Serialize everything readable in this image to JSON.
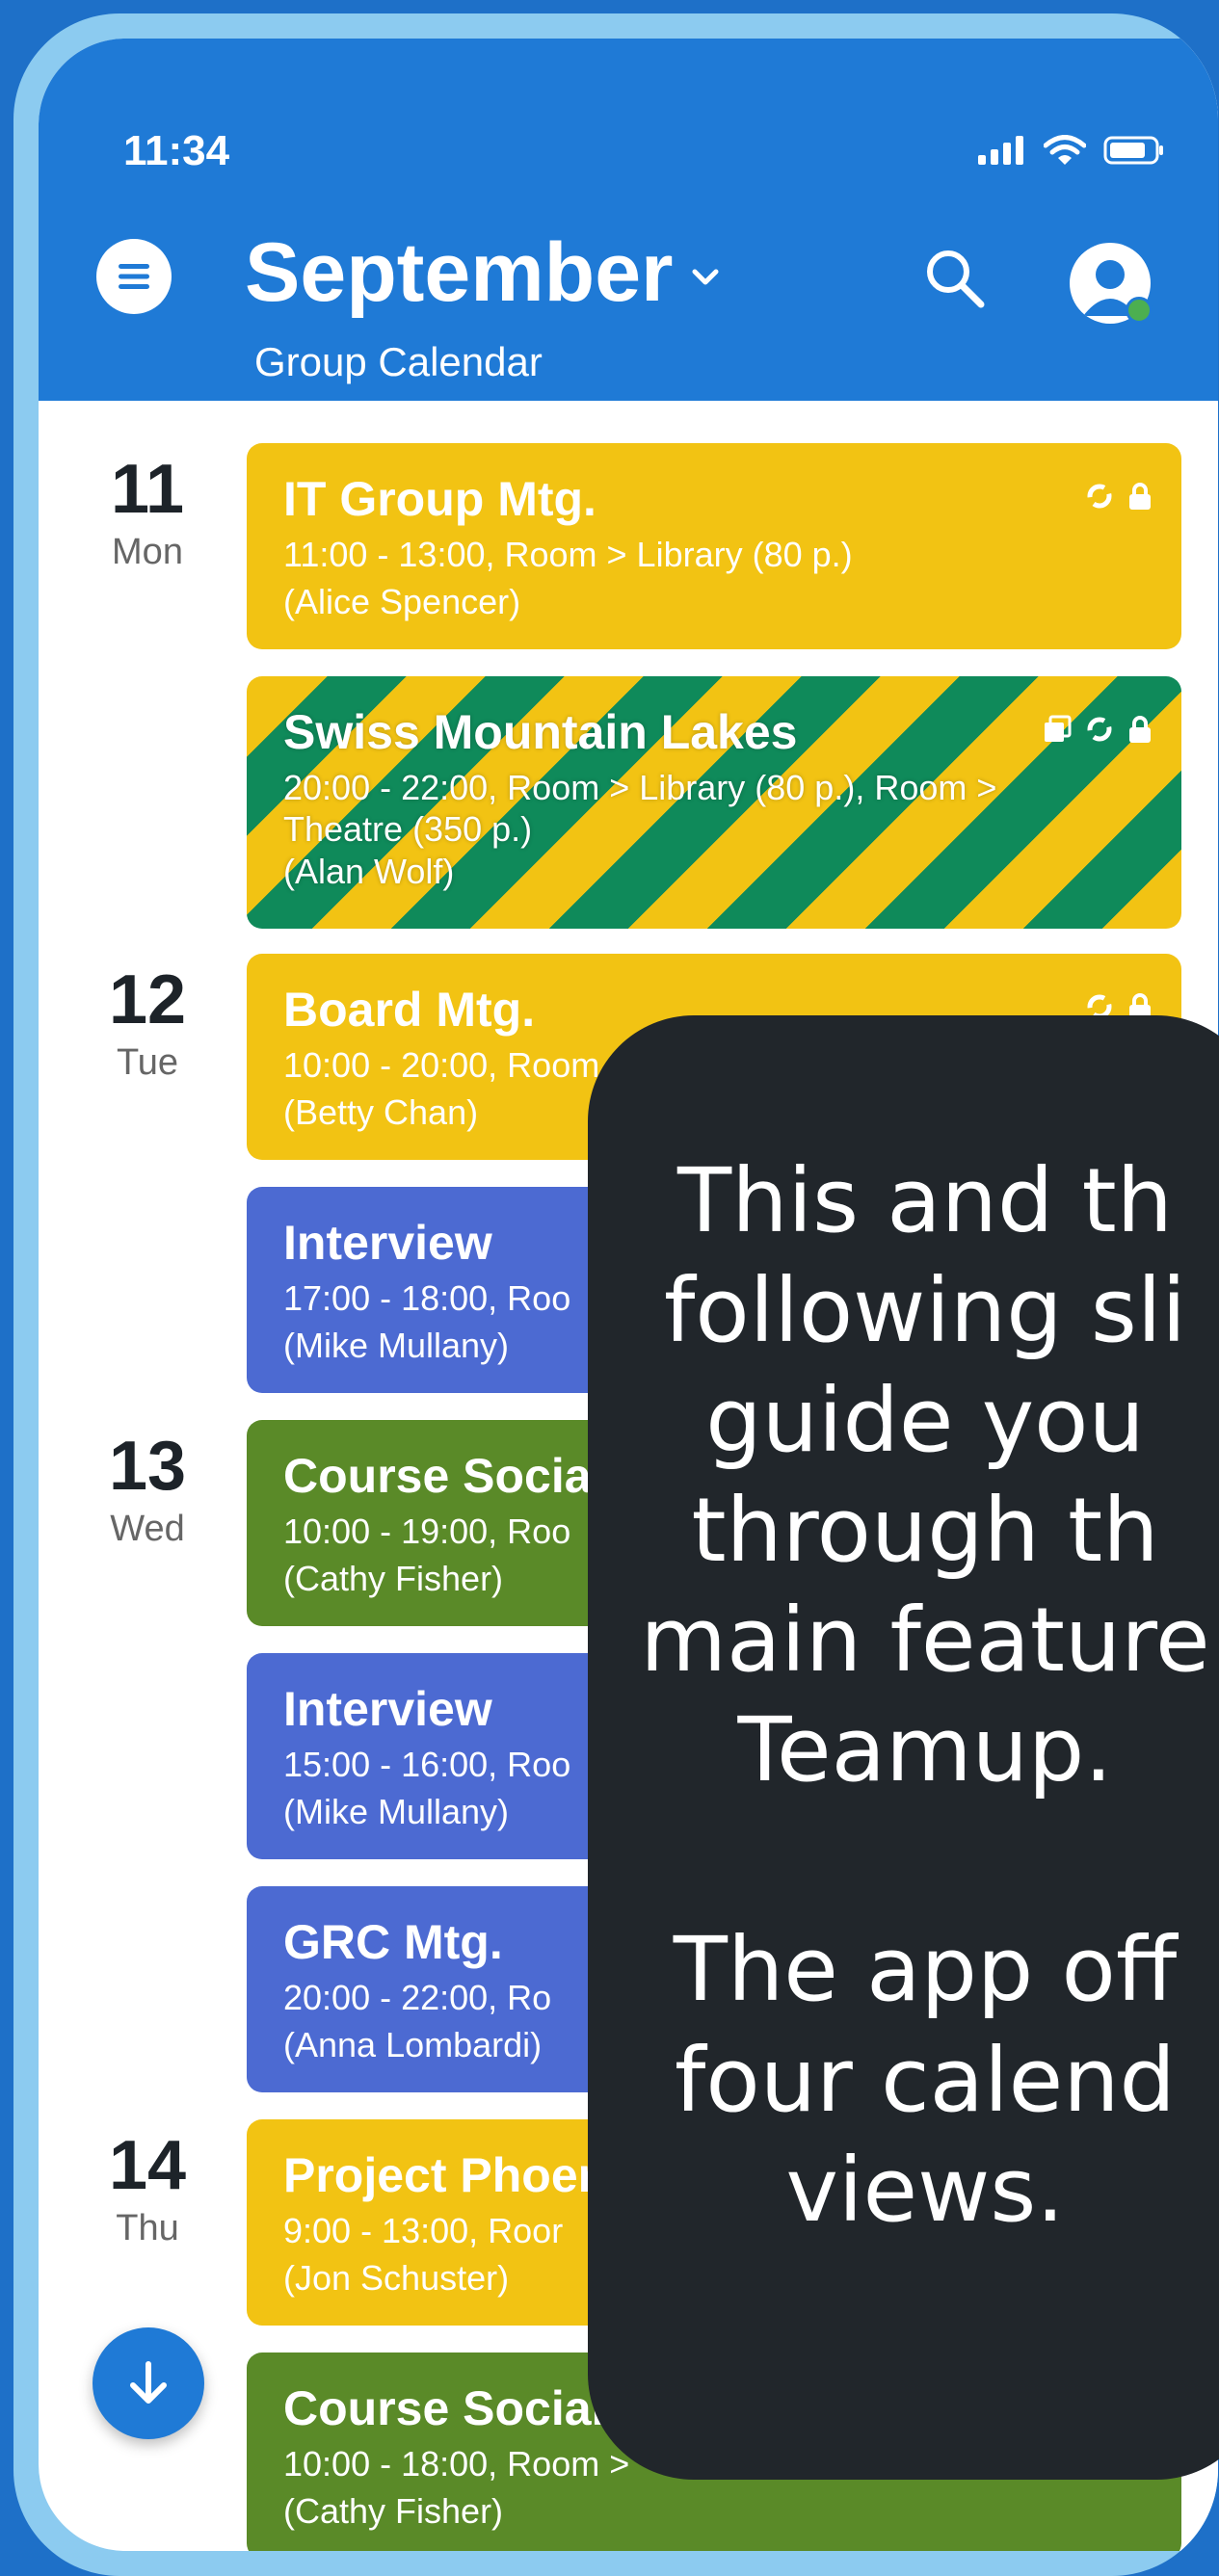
{
  "status_bar": {
    "time": "11:34"
  },
  "header": {
    "title": "September",
    "subtitle": "Group Calendar",
    "colors": {
      "header_bg": "#1f7ad6"
    }
  },
  "days": [
    {
      "num": "11",
      "weekday": "Mon"
    },
    {
      "num": "12",
      "weekday": "Tue"
    },
    {
      "num": "13",
      "weekday": "Wed"
    },
    {
      "num": "14",
      "weekday": "Thu"
    }
  ],
  "events": [
    {
      "title": "IT Group Mtg.",
      "line1": "11:00 - 13:00, Room > Library (80 p.)",
      "line2": "(Alice Spencer)",
      "color": "yellow"
    },
    {
      "title": "Swiss Mountain Lakes",
      "line1": "20:00 - 22:00, Room > Library (80 p.), Room >",
      "line2": "Theatre (350 p.)",
      "line3": "(Alan Wolf)",
      "color": "striped yellow/green"
    },
    {
      "title": "Board Mtg.",
      "line1": "10:00 - 20:00, Room",
      "line2": "(Betty Chan)",
      "color": "yellow"
    },
    {
      "title": "Interview",
      "line1": "17:00 - 18:00, Roo",
      "line2": "(Mike Mullany)",
      "color": "blue"
    },
    {
      "title": "Course Socia",
      "line1": "10:00 - 19:00, Roo",
      "line2": "(Cathy Fisher)",
      "color": "green"
    },
    {
      "title": "Interview",
      "line1": "15:00 - 16:00, Roo",
      "line2": "(Mike Mullany)",
      "color": "blue"
    },
    {
      "title": "GRC Mtg.",
      "line1": "20:00 - 22:00, Ro",
      "line2": "(Anna Lombardi)",
      "color": "blue"
    },
    {
      "title": "Project Phoer",
      "line1": "9:00 - 13:00, Roor",
      "line2": "(Jon Schuster)",
      "color": "yellow"
    },
    {
      "title": "Course Social",
      "line1": "10:00 - 18:00, Room >",
      "line2": "(Cathy Fisher)",
      "color": "green"
    }
  ],
  "overlay": {
    "lines": [
      "This and th",
      "following sli",
      "guide you",
      "through th",
      "main feature",
      "Teamup.",
      "",
      "The app off",
      "four calend",
      "views."
    ]
  }
}
